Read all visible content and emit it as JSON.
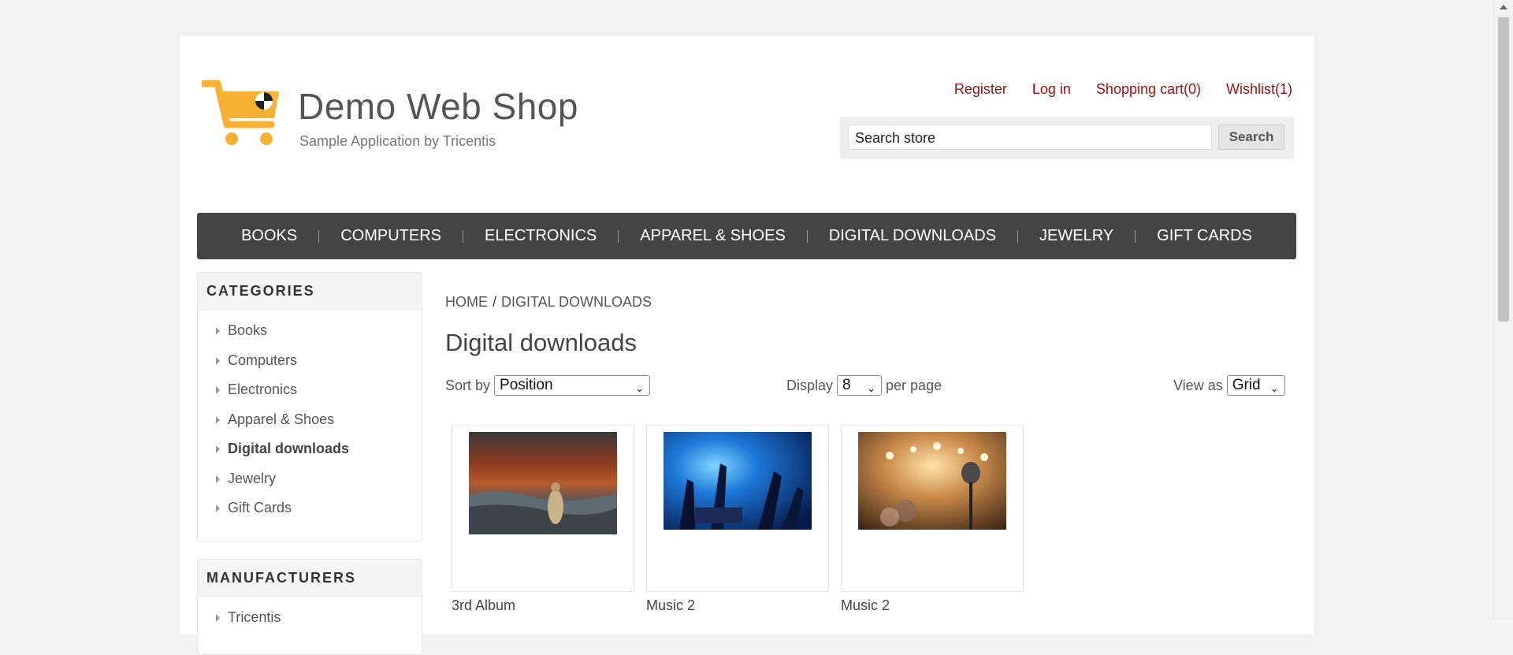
{
  "header": {
    "logo_title": "Demo Web Shop",
    "logo_subtitle": "Sample Application by Tricentis",
    "links": [
      "Register",
      "Log in",
      "Shopping cart(0)",
      "Wishlist(1)"
    ],
    "search_placeholder": "Search store",
    "search_button": "Search"
  },
  "nav": [
    "BOOKS",
    "COMPUTERS",
    "ELECTRONICS",
    "APPAREL & SHOES",
    "DIGITAL DOWNLOADS",
    "JEWELRY",
    "GIFT CARDS"
  ],
  "sidebar": {
    "categories_title": "CATEGORIES",
    "categories": [
      "Books",
      "Computers",
      "Electronics",
      "Apparel & Shoes",
      "Digital downloads",
      "Jewelry",
      "Gift Cards"
    ],
    "active_category": "Digital downloads",
    "manufacturers_title": "MANUFACTURERS",
    "manufacturers": [
      "Tricentis"
    ]
  },
  "breadcrumb": {
    "home": "HOME",
    "separator": "/",
    "current": "DIGITAL DOWNLOADS"
  },
  "page_title": "Digital downloads",
  "controls": {
    "sort_label": "Sort by",
    "sort_value": "Position",
    "display_label": "Display",
    "display_value": "8",
    "per_page_label": "per page",
    "view_label": "View as",
    "view_value": "Grid"
  },
  "products": [
    {
      "title": "3rd Album",
      "image": "album-storm-image"
    },
    {
      "title": "Music 2",
      "image": "concert-crowd-image"
    },
    {
      "title": "Music 2",
      "image": "microphone-stage-image"
    }
  ],
  "colors": {
    "link": "#991111",
    "nav_bg": "#444444",
    "logo_orange": "#f9b133"
  }
}
